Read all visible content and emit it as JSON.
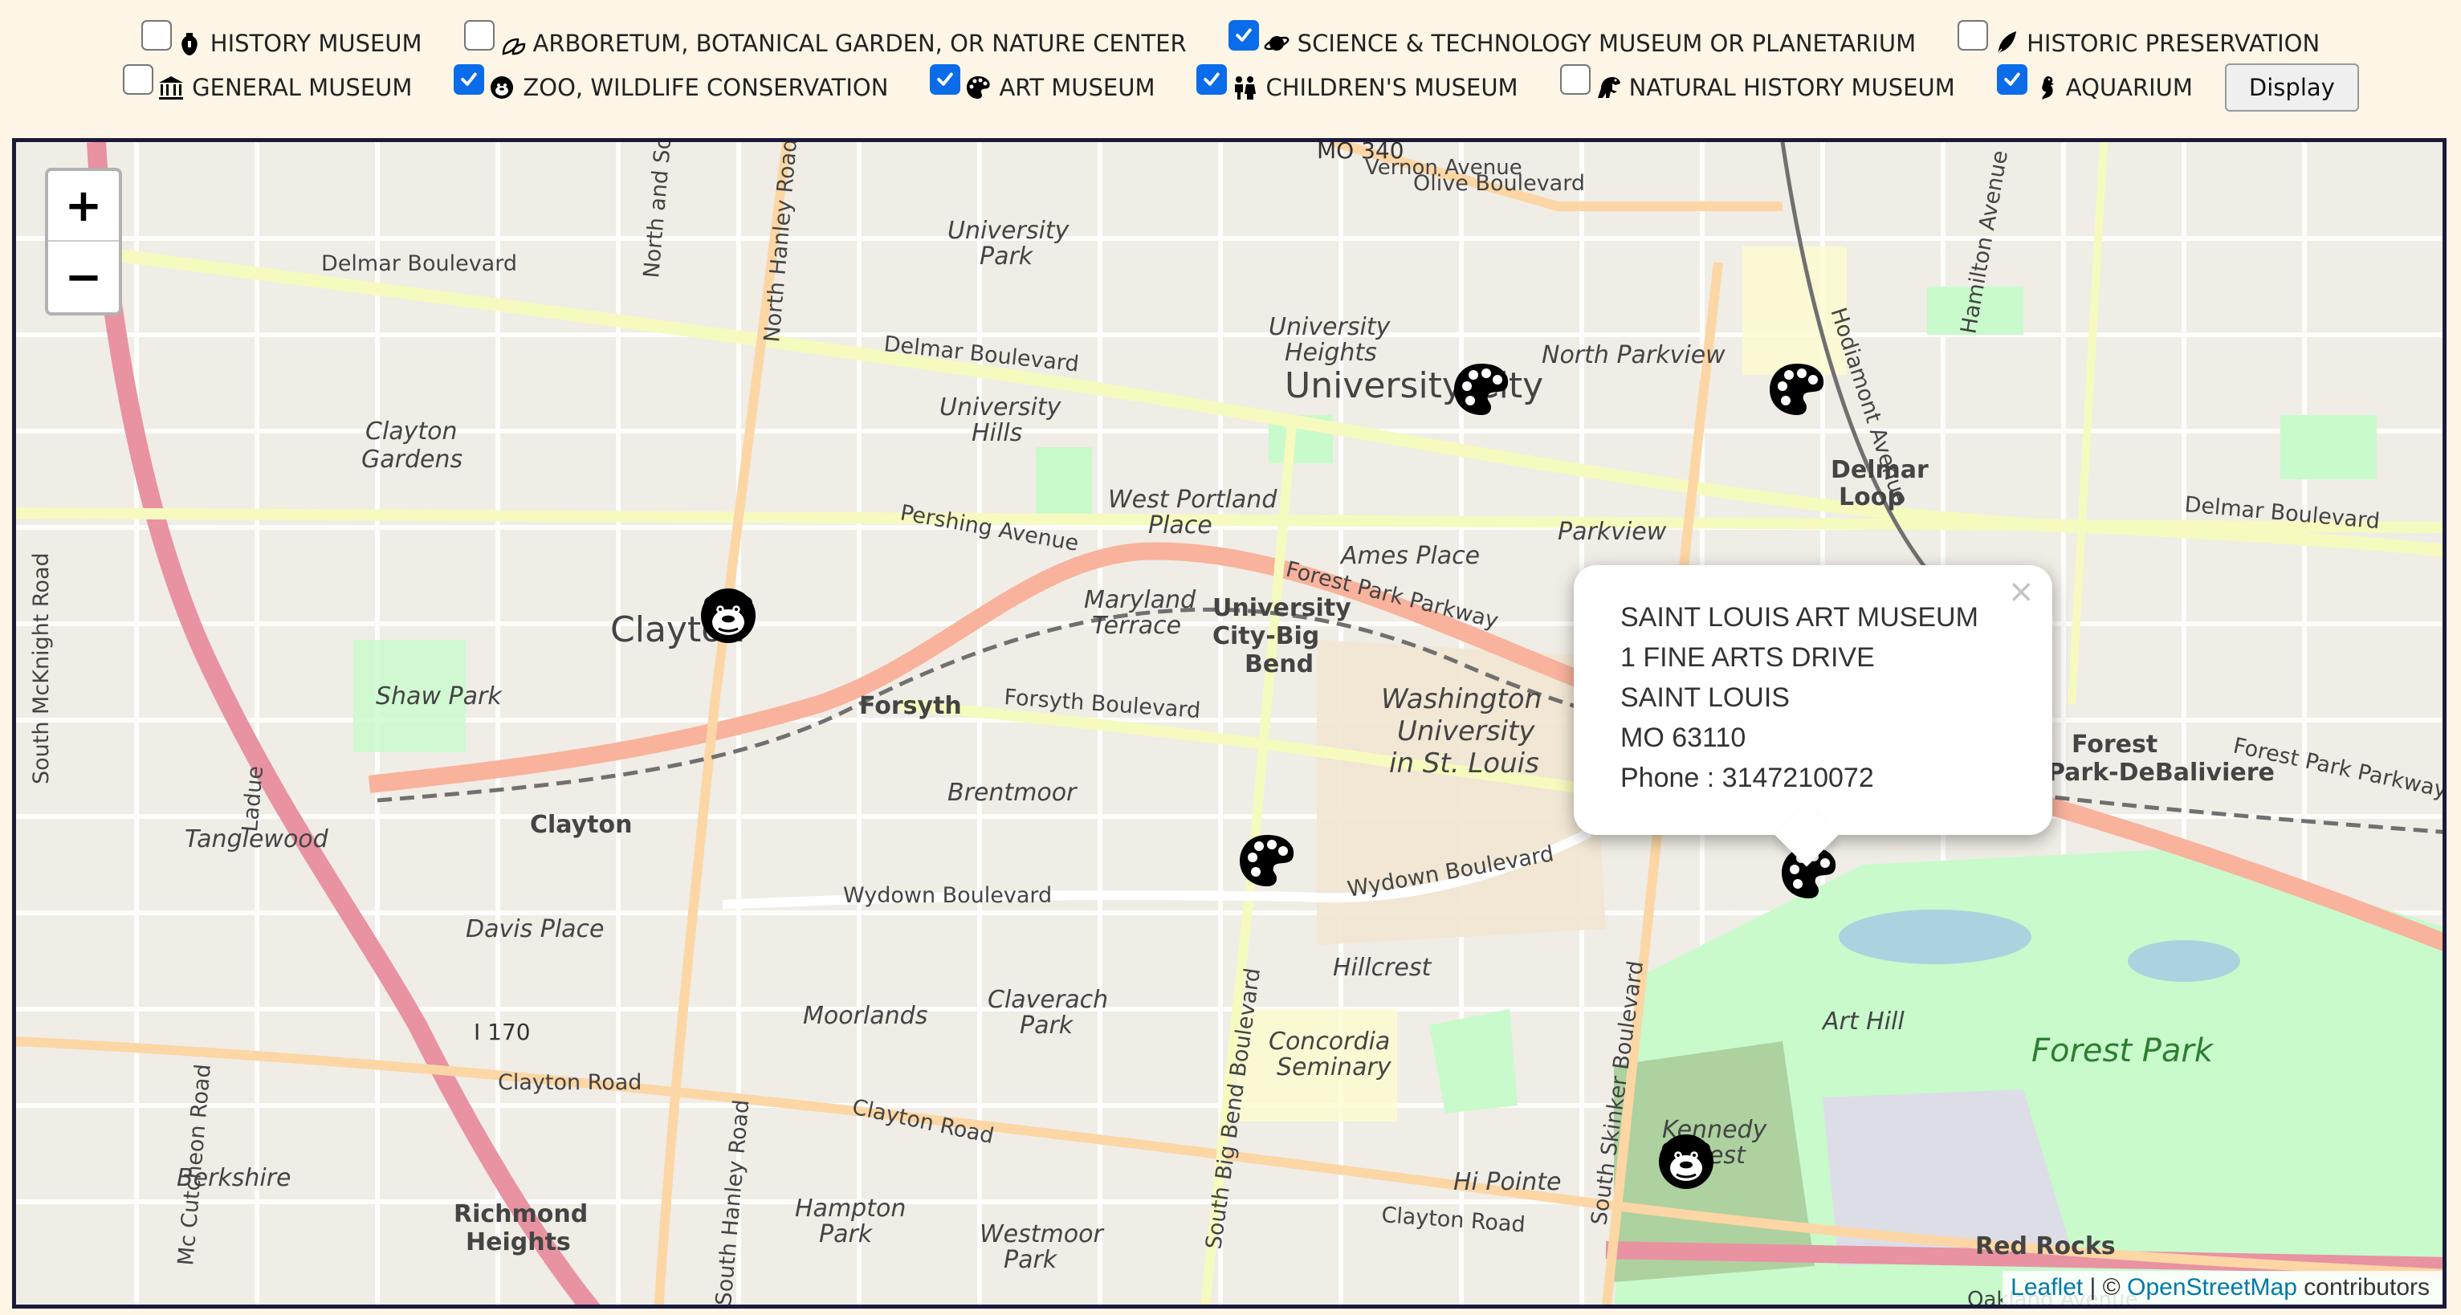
{
  "filters": {
    "row1": [
      {
        "label": "HISTORY MUSEUM",
        "checked": false,
        "icon": "vase-icon"
      },
      {
        "label": "ARBORETUM, BOTANICAL GARDEN, OR NATURE CENTER",
        "checked": false,
        "icon": "leaves-icon"
      },
      {
        "label": "SCIENCE & TECHNOLOGY MUSEUM OR PLANETARIUM",
        "checked": true,
        "icon": "planet-icon"
      },
      {
        "label": "HISTORIC PRESERVATION",
        "checked": false,
        "icon": "quill-icon"
      }
    ],
    "row2": [
      {
        "label": "GENERAL MUSEUM",
        "checked": false,
        "icon": "museum-building-icon"
      },
      {
        "label": "ZOO, WILDLIFE CONSERVATION",
        "checked": true,
        "icon": "gorilla-icon"
      },
      {
        "label": "ART MUSEUM",
        "checked": true,
        "icon": "palette-icon"
      },
      {
        "label": "CHILDREN'S MUSEUM",
        "checked": true,
        "icon": "children-icon"
      },
      {
        "label": "NATURAL HISTORY MUSEUM",
        "checked": false,
        "icon": "dinosaur-icon"
      },
      {
        "label": "AQUARIUM",
        "checked": true,
        "icon": "seahorse-icon"
      }
    ],
    "display_label": "Display"
  },
  "map": {
    "zoom_in": "+",
    "zoom_out": "−",
    "places": [
      "Clayton",
      "University City",
      "Forest Park",
      "Delmar Loop",
      "Brentmoor",
      "Hillcrest",
      "Shaw Park",
      "Tanglewood",
      "Davis Place",
      "Moorlands",
      "Claverach Park",
      "Concordia Seminary",
      "Art Hill",
      "Kennedy Forest",
      "Red Rocks",
      "Hi Pointe",
      "Hampton Park",
      "Westmoor Park",
      "Berkshire",
      "Richmond Heights",
      "University Park",
      "University Heights",
      "North Parkview",
      "University Hills",
      "West Portland Place",
      "Ames Place",
      "Parkview",
      "Maryland Terrace",
      "Clayton Gardens",
      "Washington University in St. Louis",
      "University City-Big Bend",
      "Forsyth",
      "Forest Park-DeBaliviere",
      "I 170",
      "MO 340"
    ],
    "roads": [
      "Delmar Boulevard",
      "Olive Boulevard",
      "Vernon Avenue",
      "Pershing Avenue",
      "Forest Park Parkway",
      "Forsyth Boulevard",
      "Wydown Boulevard",
      "Clayton Road",
      "North Hanley Road",
      "South Hanley Road",
      "South Big Bend Boulevard",
      "South Skinker Boulevard",
      "Hodiamont Avenue",
      "Hamilton Avenue",
      "North and South",
      "South McKnight Road",
      "Mc Cutcheon Road",
      "Oakland Avenue",
      "Ladue",
      "Forest Park Parkway"
    ],
    "markers": [
      {
        "type": "gorilla",
        "name": "zoo-marker-clayton"
      },
      {
        "type": "palette",
        "name": "art-marker-university-city"
      },
      {
        "type": "palette",
        "name": "art-marker-delmar-loop"
      },
      {
        "type": "palette",
        "name": "art-marker-wydown"
      },
      {
        "type": "palette",
        "name": "art-marker-forest-park"
      },
      {
        "type": "gorilla",
        "name": "zoo-marker-forest-park"
      }
    ],
    "popup": {
      "name": "SAINT LOUIS ART MUSEUM",
      "address": "1 FINE ARTS DRIVE",
      "city": "SAINT LOUIS",
      "state_zip": "MO 63110",
      "phone": "Phone : 3147210072",
      "close": "×"
    },
    "attribution": {
      "leaflet": "Leaflet",
      "sep": " | © ",
      "osm": "OpenStreetMap",
      "rest": " contributors"
    }
  },
  "colors": {
    "checkbox_on": "#0a6ce8",
    "map_border": "#1c1a3a",
    "page_bg": "#fdf5e6",
    "park": "#c8facc",
    "motorway": "#e892a2",
    "trunk": "#f9b29c",
    "secondary": "#f7fabf",
    "link": "#0078a8"
  }
}
